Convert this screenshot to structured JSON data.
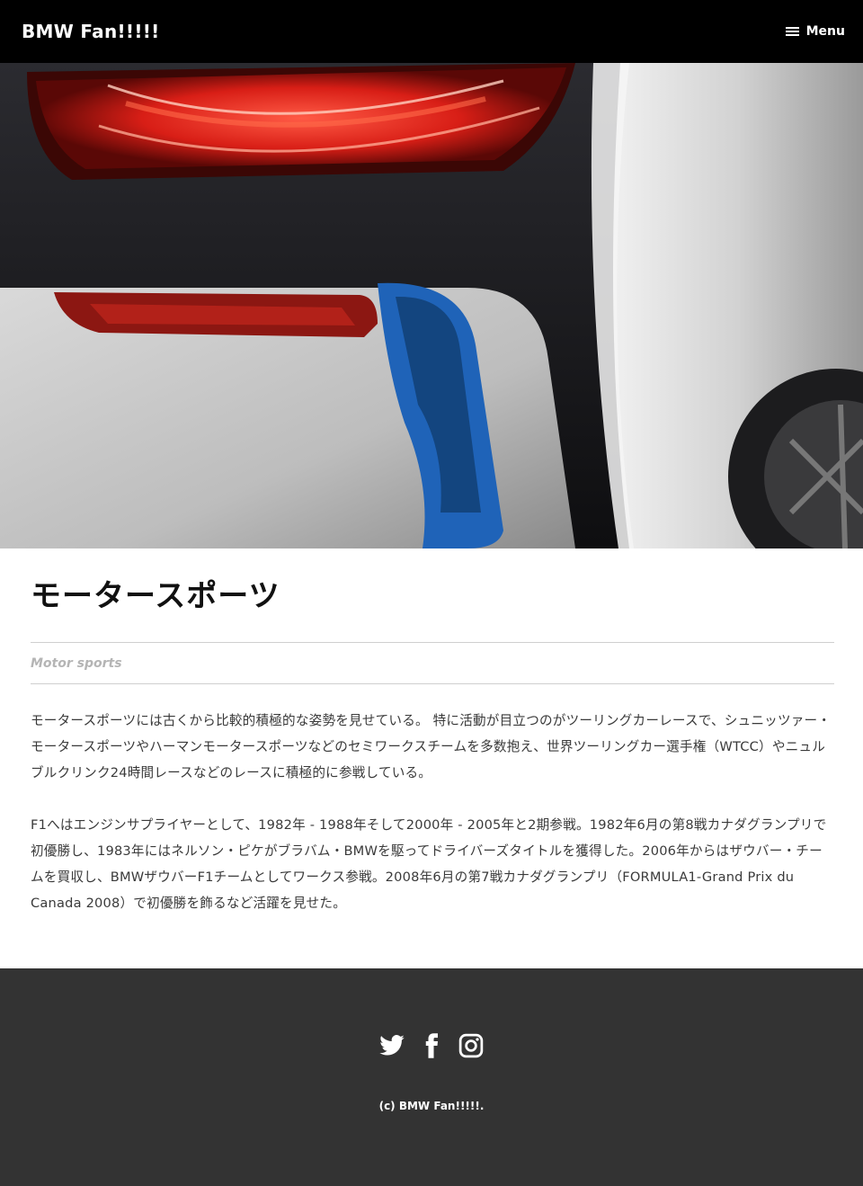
{
  "header": {
    "site_title": "BMW Fan!!!!!",
    "menu_label": "Menu"
  },
  "article": {
    "title": "モータースポーツ",
    "subtitle": "Motor sports",
    "paragraphs": [
      "モータースポーツには古くから比較的積極的な姿勢を見せている。 特に活動が目立つのがツーリングカーレースで、シュニッツァー・モータースポーツやハーマンモータースポーツなどのセミワークスチームを多数抱え、世界ツーリングカー選手権（WTCC）やニュルブルクリンク24時間レースなどのレースに積極的に参戦している。",
      "F1へはエンジンサプライヤーとして、1982年 - 1988年そして2000年 - 2005年と2期参戦。1982年6月の第8戦カナダグランプリで初優勝し、1983年にはネルソン・ピケがブラバム・BMWを駆ってドライバーズタイトルを獲得した。2006年からはザウバー・チームを買収し、BMWザウバーF1チームとしてワークス参戦。2008年6月の第7戦カナダグランプリ（FORMULA1-Grand Prix du Canada 2008）で初優勝を飾るなど活躍を見せた。"
    ]
  },
  "footer": {
    "social_icons": [
      "twitter-icon",
      "facebook-icon",
      "instagram-icon"
    ],
    "copyright": "(c) BMW Fan!!!!!."
  },
  "colors": {
    "header_bg": "#000000",
    "footer_bg": "#333333",
    "tail_light_red": "#e0221b",
    "accent_blue": "#1f63b8"
  }
}
